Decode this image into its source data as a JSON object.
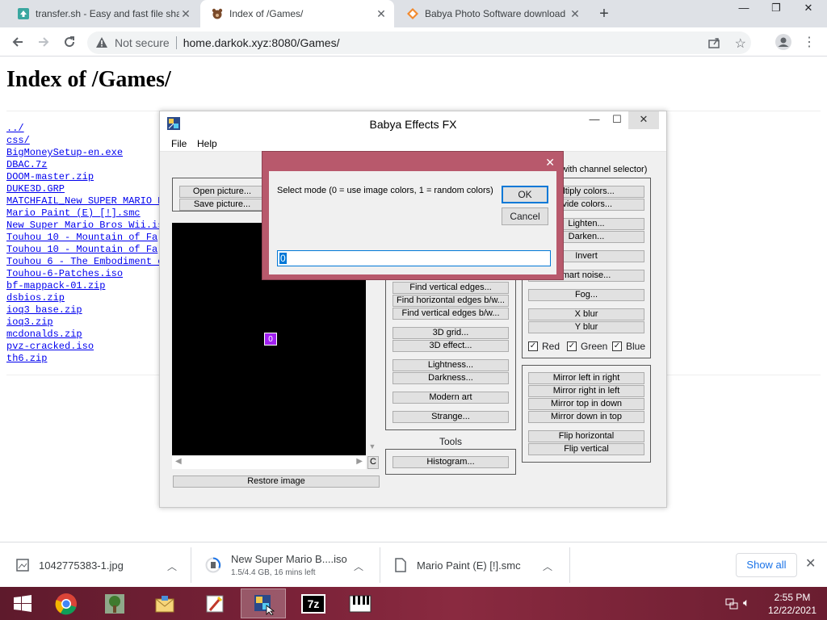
{
  "browser": {
    "tabs": [
      {
        "title": "transfer.sh - Easy and fast file sha",
        "active": false
      },
      {
        "title": "Index of /Games/",
        "active": true
      },
      {
        "title": "Babya Photo Software download",
        "active": false
      }
    ],
    "security_label": "Not secure",
    "url": "home.darkok.xyz:8080/Games/"
  },
  "page": {
    "heading": "Index of /Games/",
    "files": [
      "../",
      "css/",
      "BigMoneySetup-en.exe",
      "DBAC.7z",
      "DOOM-master.zip",
      "DUKE3D.GRP",
      "MATCHFAIL_New SUPER MARIO B",
      "Mario Paint (E) [!].smc",
      "New Super Mario Bros Wii.is",
      "Touhou 10 - Mountain of Fa",
      "Touhou 10 - Mountain of Fa",
      "Touhou 6 - The Embodiment o",
      "Touhou-6-Patches.iso",
      "bf-mappack-01.zip",
      "dsbios.zip",
      "ioq3 base.zip",
      "ioq3.zip",
      "mcdonalds.zip",
      "pvz-cracked.iso",
      "th6.zip"
    ]
  },
  "app": {
    "title": "Babya Effects FX",
    "menu": {
      "file": "File",
      "help": "Help"
    },
    "open_button": "Open picture...",
    "save_button": "Save picture...",
    "channel_group_label": "with channel selector)",
    "effects": {
      "find_vertical_edges": "Find vertical edges...",
      "find_horizontal_edges_bw": "Find horizontal edges b/w...",
      "find_vertical_edges_bw": "Find vertical edges b/w...",
      "grid_3d": "3D grid...",
      "effect_3d": "3D effect...",
      "lightness": "Lightness...",
      "darkness": "Darkness...",
      "modern_art": "Modern art",
      "strange": "Strange..."
    },
    "channel_effects": {
      "multiply": "ultiply colors...",
      "divide": "ivide colors...",
      "lighten": "Lighten...",
      "darken": "Darken...",
      "invert": "Invert",
      "smart_noise": "mart noise...",
      "fog": "Fog...",
      "x_blur": "X blur",
      "y_blur": "Y blur"
    },
    "channels": {
      "red": "Red",
      "green": "Green",
      "blue": "Blue"
    },
    "mirror": {
      "left_in_right": "Mirror left in right",
      "right_in_left": "Mirror right in left",
      "top_in_down": "Mirror top in down",
      "down_in_top": "Mirror down in top",
      "flip_horizontal": "Flip horizontal",
      "flip_vertical": "Flip vertical"
    },
    "tools_label": "Tools",
    "histogram_button": "Histogram...",
    "restore_button": "Restore image",
    "c_button": "C"
  },
  "dialog": {
    "prompt": "Select mode (0 = use image colors, 1 = random colors)",
    "ok": "OK",
    "cancel": "Cancel",
    "input_value": "0"
  },
  "downloads": {
    "items": [
      {
        "name": "1042775383-1.jpg",
        "sub": ""
      },
      {
        "name": "New Super Mario B....iso",
        "sub": "1.5/4.4 GB, 16 mins left"
      },
      {
        "name": "Mario Paint (E) [!].smc",
        "sub": ""
      }
    ],
    "show_all": "Show all"
  },
  "taskbar": {
    "time": "2:55 PM",
    "date": "12/22/2021"
  }
}
